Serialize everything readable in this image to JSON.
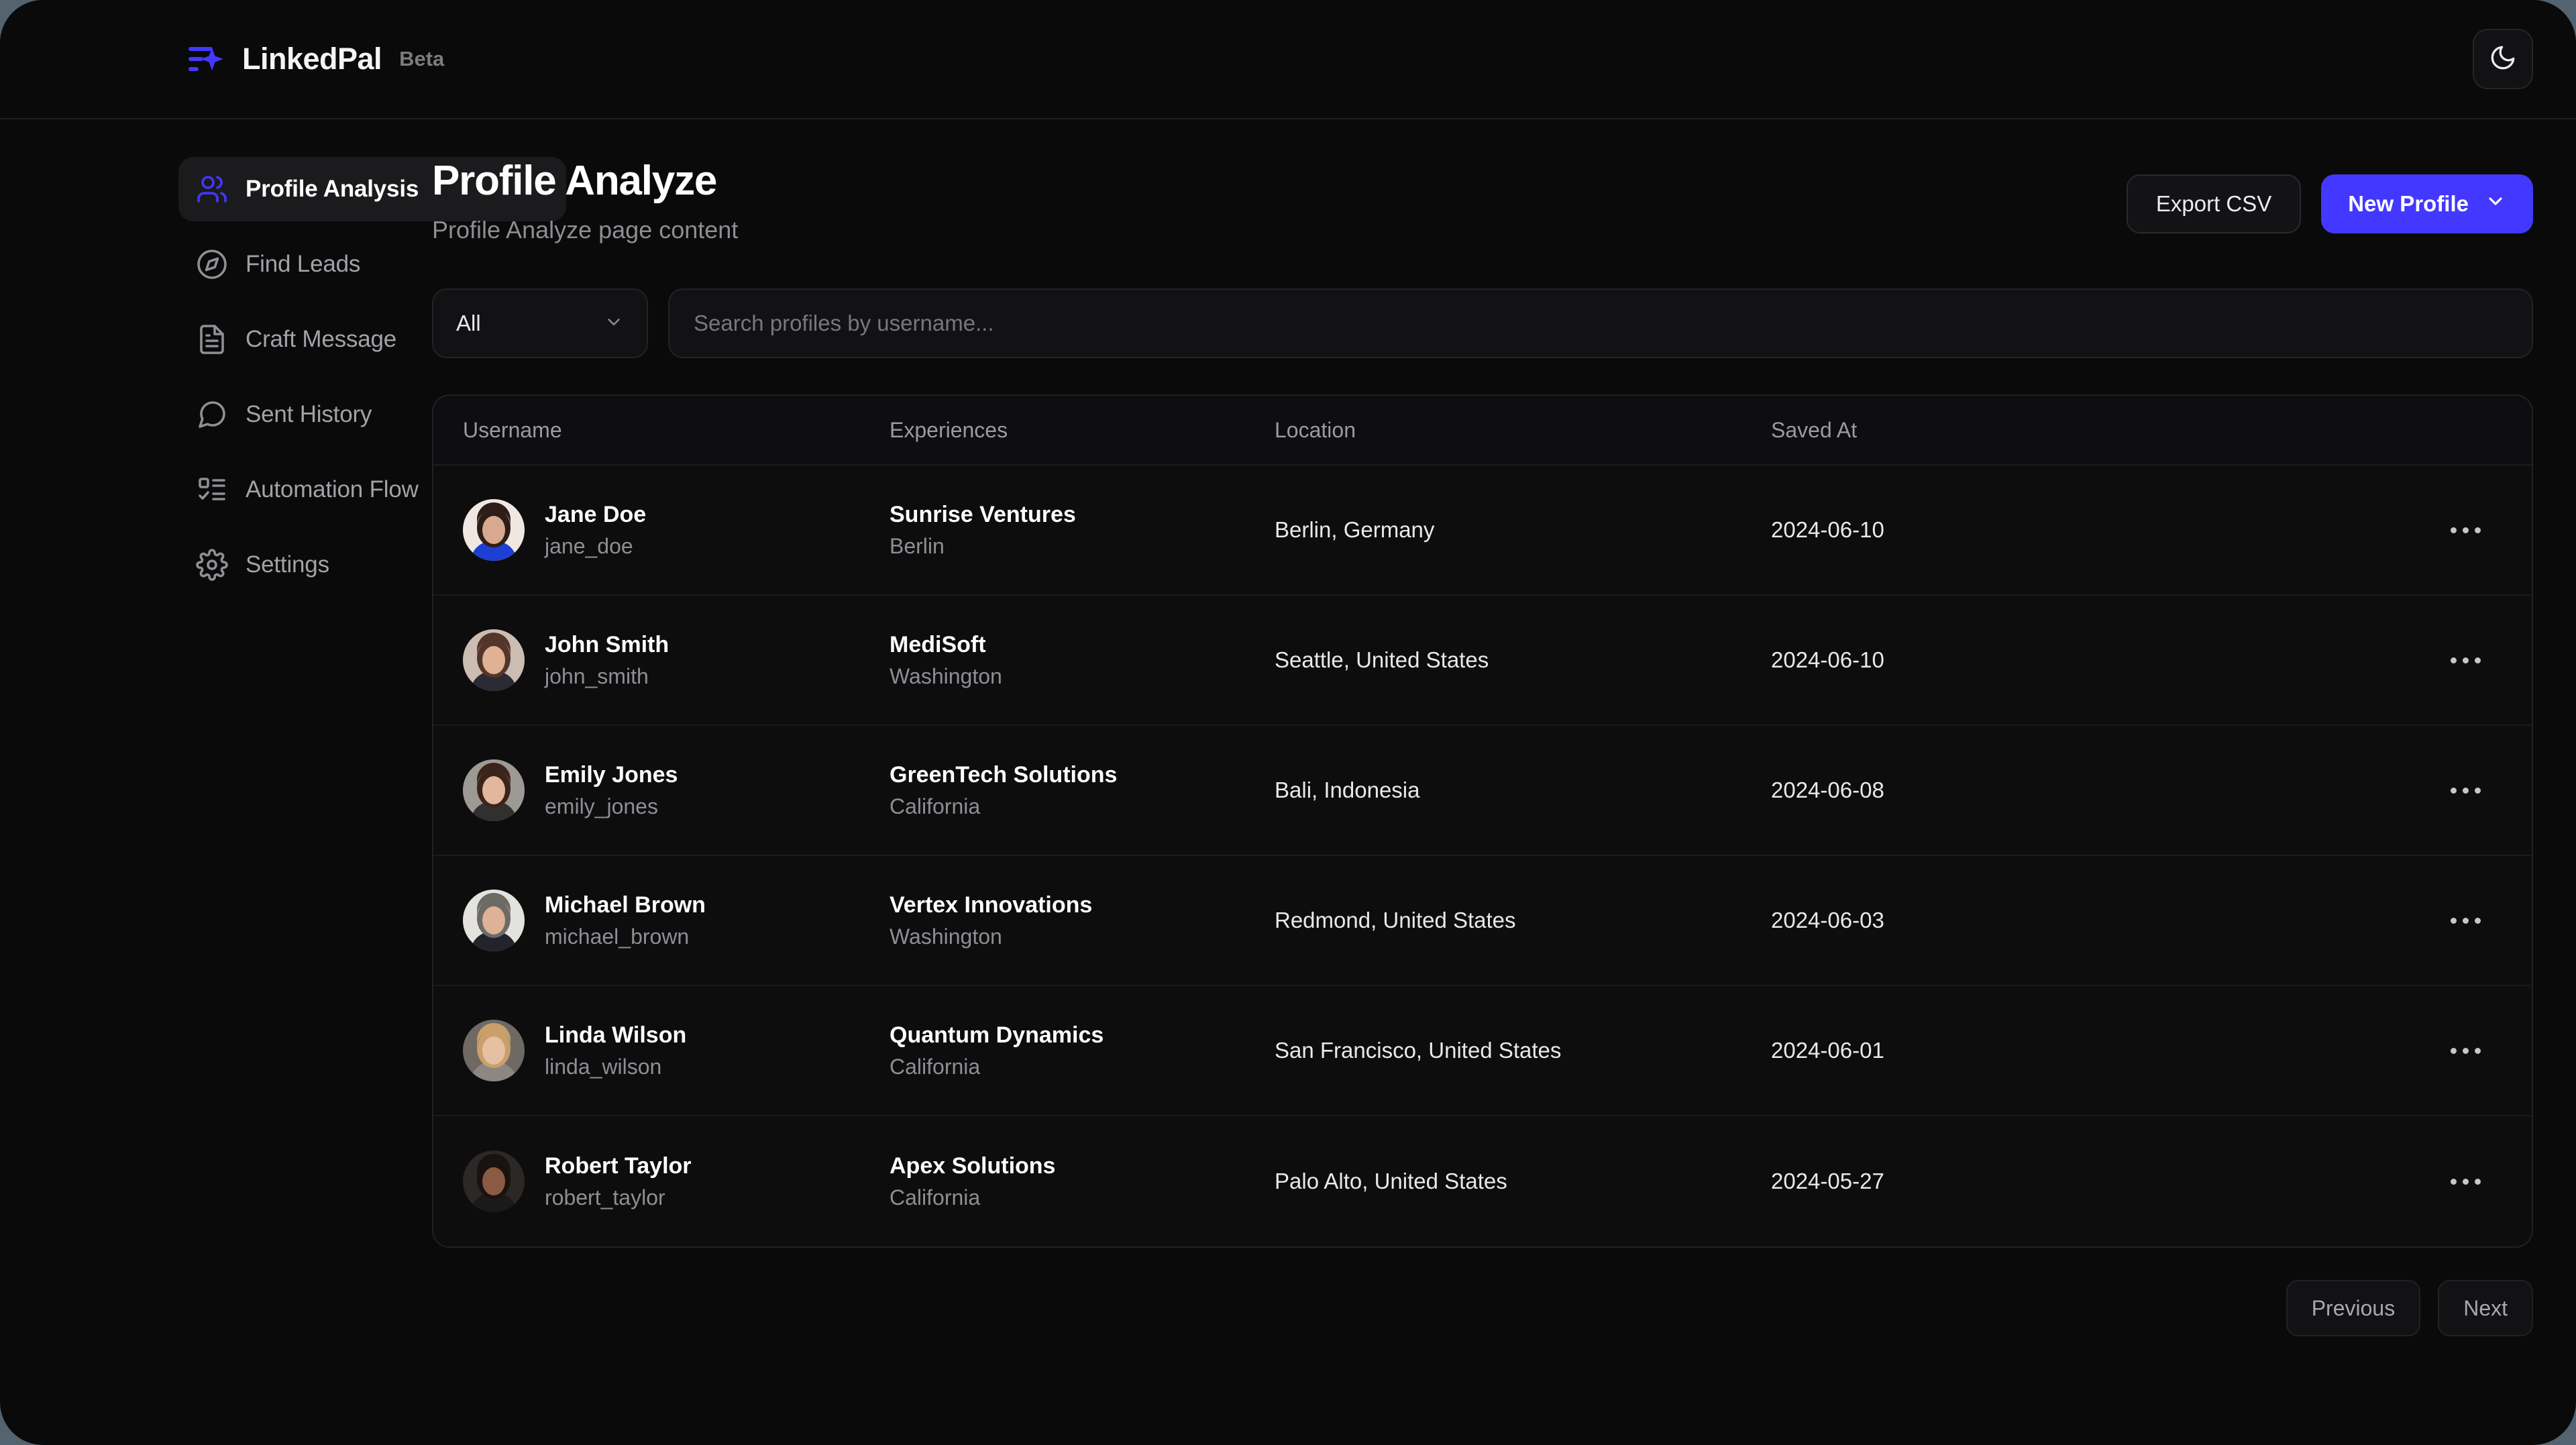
{
  "brand": {
    "name": "LinkedPal",
    "badge": "Beta",
    "logo_icon": "lines-sparkle-icon",
    "accent_color": "#4338ff"
  },
  "topbar": {
    "theme_toggle_icon": "moon-icon"
  },
  "sidebar": {
    "items": [
      {
        "label": "Profile Analysis",
        "icon": "users-icon",
        "active": true
      },
      {
        "label": "Find Leads",
        "icon": "compass-icon",
        "active": false
      },
      {
        "label": "Craft Message",
        "icon": "document-icon",
        "active": false
      },
      {
        "label": "Sent History",
        "icon": "chat-bubble-icon",
        "active": false
      },
      {
        "label": "Automation Flow",
        "icon": "list-checks-icon",
        "active": false
      },
      {
        "label": "Settings",
        "icon": "gear-icon",
        "active": false
      }
    ]
  },
  "page": {
    "title": "Profile Analyze",
    "subtitle": "Profile Analyze page content",
    "export_label": "Export CSV",
    "new_profile_label": "New Profile",
    "new_profile_icon": "chevron-down-icon"
  },
  "filters": {
    "select_value": "All",
    "select_icon": "chevron-down-icon",
    "search_placeholder": "Search profiles by username...",
    "search_value": ""
  },
  "table": {
    "columns": [
      "Username",
      "Experiences",
      "Location",
      "Saved At"
    ],
    "row_menu_icon": "more-horizontal-icon",
    "rows": [
      {
        "name": "Jane Doe",
        "handle": "jane_doe",
        "company": "Sunrise Ventures",
        "company_location": "Berlin",
        "location": "Berlin, Germany",
        "saved_at": "2024-06-10",
        "avatar": {
          "skin": "#d8a98f",
          "hair": "#2e1d16",
          "bg": "#efe8e2",
          "shirt": "#1d3fd4"
        }
      },
      {
        "name": "John Smith",
        "handle": "john_smith",
        "company": "MediSoft",
        "company_location": "Washington",
        "location": "Seattle, United States",
        "saved_at": "2024-06-10",
        "avatar": {
          "skin": "#e0b193",
          "hair": "#54352a",
          "bg": "#cbbdb2",
          "shirt": "#2c2a33"
        }
      },
      {
        "name": "Emily Jones",
        "handle": "emily_jones",
        "company": "GreenTech Solutions",
        "company_location": "California",
        "location": "Bali, Indonesia",
        "saved_at": "2024-06-08",
        "avatar": {
          "skin": "#e2b79c",
          "hair": "#3b241a",
          "bg": "#9d9a96",
          "shirt": "#31302f"
        }
      },
      {
        "name": "Michael Brown",
        "handle": "michael_brown",
        "company": "Vertex Innovations",
        "company_location": "Washington",
        "location": "Redmond, United States",
        "saved_at": "2024-06-03",
        "avatar": {
          "skin": "#ddb296",
          "hair": "#6d6a66",
          "bg": "#e4e2de",
          "shirt": "#23242b"
        }
      },
      {
        "name": "Linda Wilson",
        "handle": "linda_wilson",
        "company": "Quantum Dynamics",
        "company_location": "California",
        "location": "San Francisco, United States",
        "saved_at": "2024-06-01",
        "avatar": {
          "skin": "#e6c0a2",
          "hair": "#c9a06a",
          "bg": "#6e6963",
          "shirt": "#8c8780"
        }
      },
      {
        "name": "Robert Taylor",
        "handle": "robert_taylor",
        "company": "Apex Solutions",
        "company_location": "California",
        "location": "Palo Alto, United States",
        "saved_at": "2024-05-27",
        "avatar": {
          "skin": "#8a5a42",
          "hair": "#1a1210",
          "bg": "#2b2826",
          "shirt": "#1c1a19"
        }
      }
    ]
  },
  "pagination": {
    "previous_label": "Previous",
    "next_label": "Next"
  }
}
